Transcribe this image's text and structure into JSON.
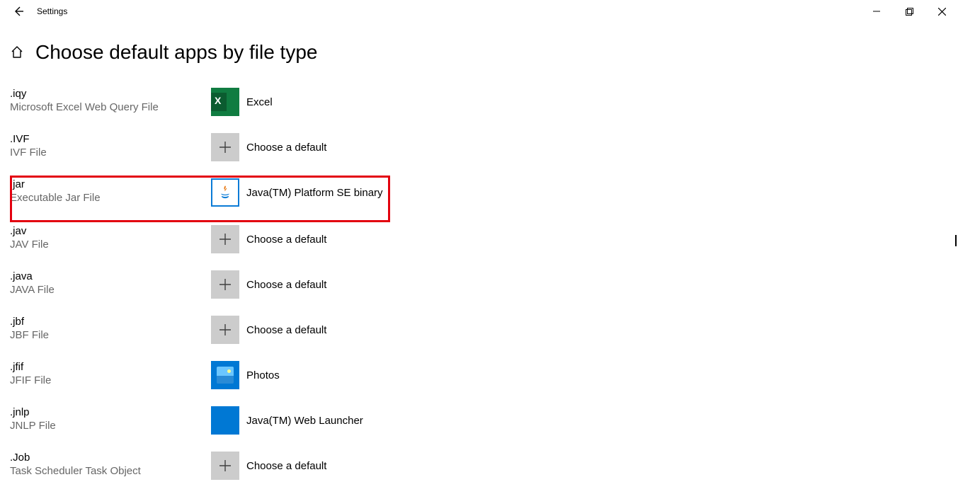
{
  "window": {
    "app_title": "Settings"
  },
  "page": {
    "title": "Choose default apps by file type"
  },
  "defaults": {
    "choose_label": "Choose a default"
  },
  "rows": [
    {
      "ext": ".iqy",
      "desc": "Microsoft Excel Web Query File",
      "app": "Excel",
      "icon": "excel",
      "highlight": false
    },
    {
      "ext": ".IVF",
      "desc": "IVF File",
      "app": "Choose a default",
      "icon": "plus",
      "highlight": false
    },
    {
      "ext": ".jar",
      "desc": "Executable Jar File",
      "app": "Java(TM) Platform SE binary",
      "icon": "java",
      "highlight": true
    },
    {
      "ext": ".jav",
      "desc": "JAV File",
      "app": "Choose a default",
      "icon": "plus",
      "highlight": false
    },
    {
      "ext": ".java",
      "desc": "JAVA File",
      "app": "Choose a default",
      "icon": "plus",
      "highlight": false
    },
    {
      "ext": ".jbf",
      "desc": "JBF File",
      "app": "Choose a default",
      "icon": "plus",
      "highlight": false
    },
    {
      "ext": ".jfif",
      "desc": "JFIF File",
      "app": "Photos",
      "icon": "photos",
      "highlight": false
    },
    {
      "ext": ".jnlp",
      "desc": "JNLP File",
      "app": "Java(TM) Web Launcher",
      "icon": "jnlp",
      "highlight": false
    },
    {
      "ext": ".Job",
      "desc": "Task Scheduler Task Object",
      "app": "Choose a default",
      "icon": "plus",
      "highlight": false
    }
  ]
}
